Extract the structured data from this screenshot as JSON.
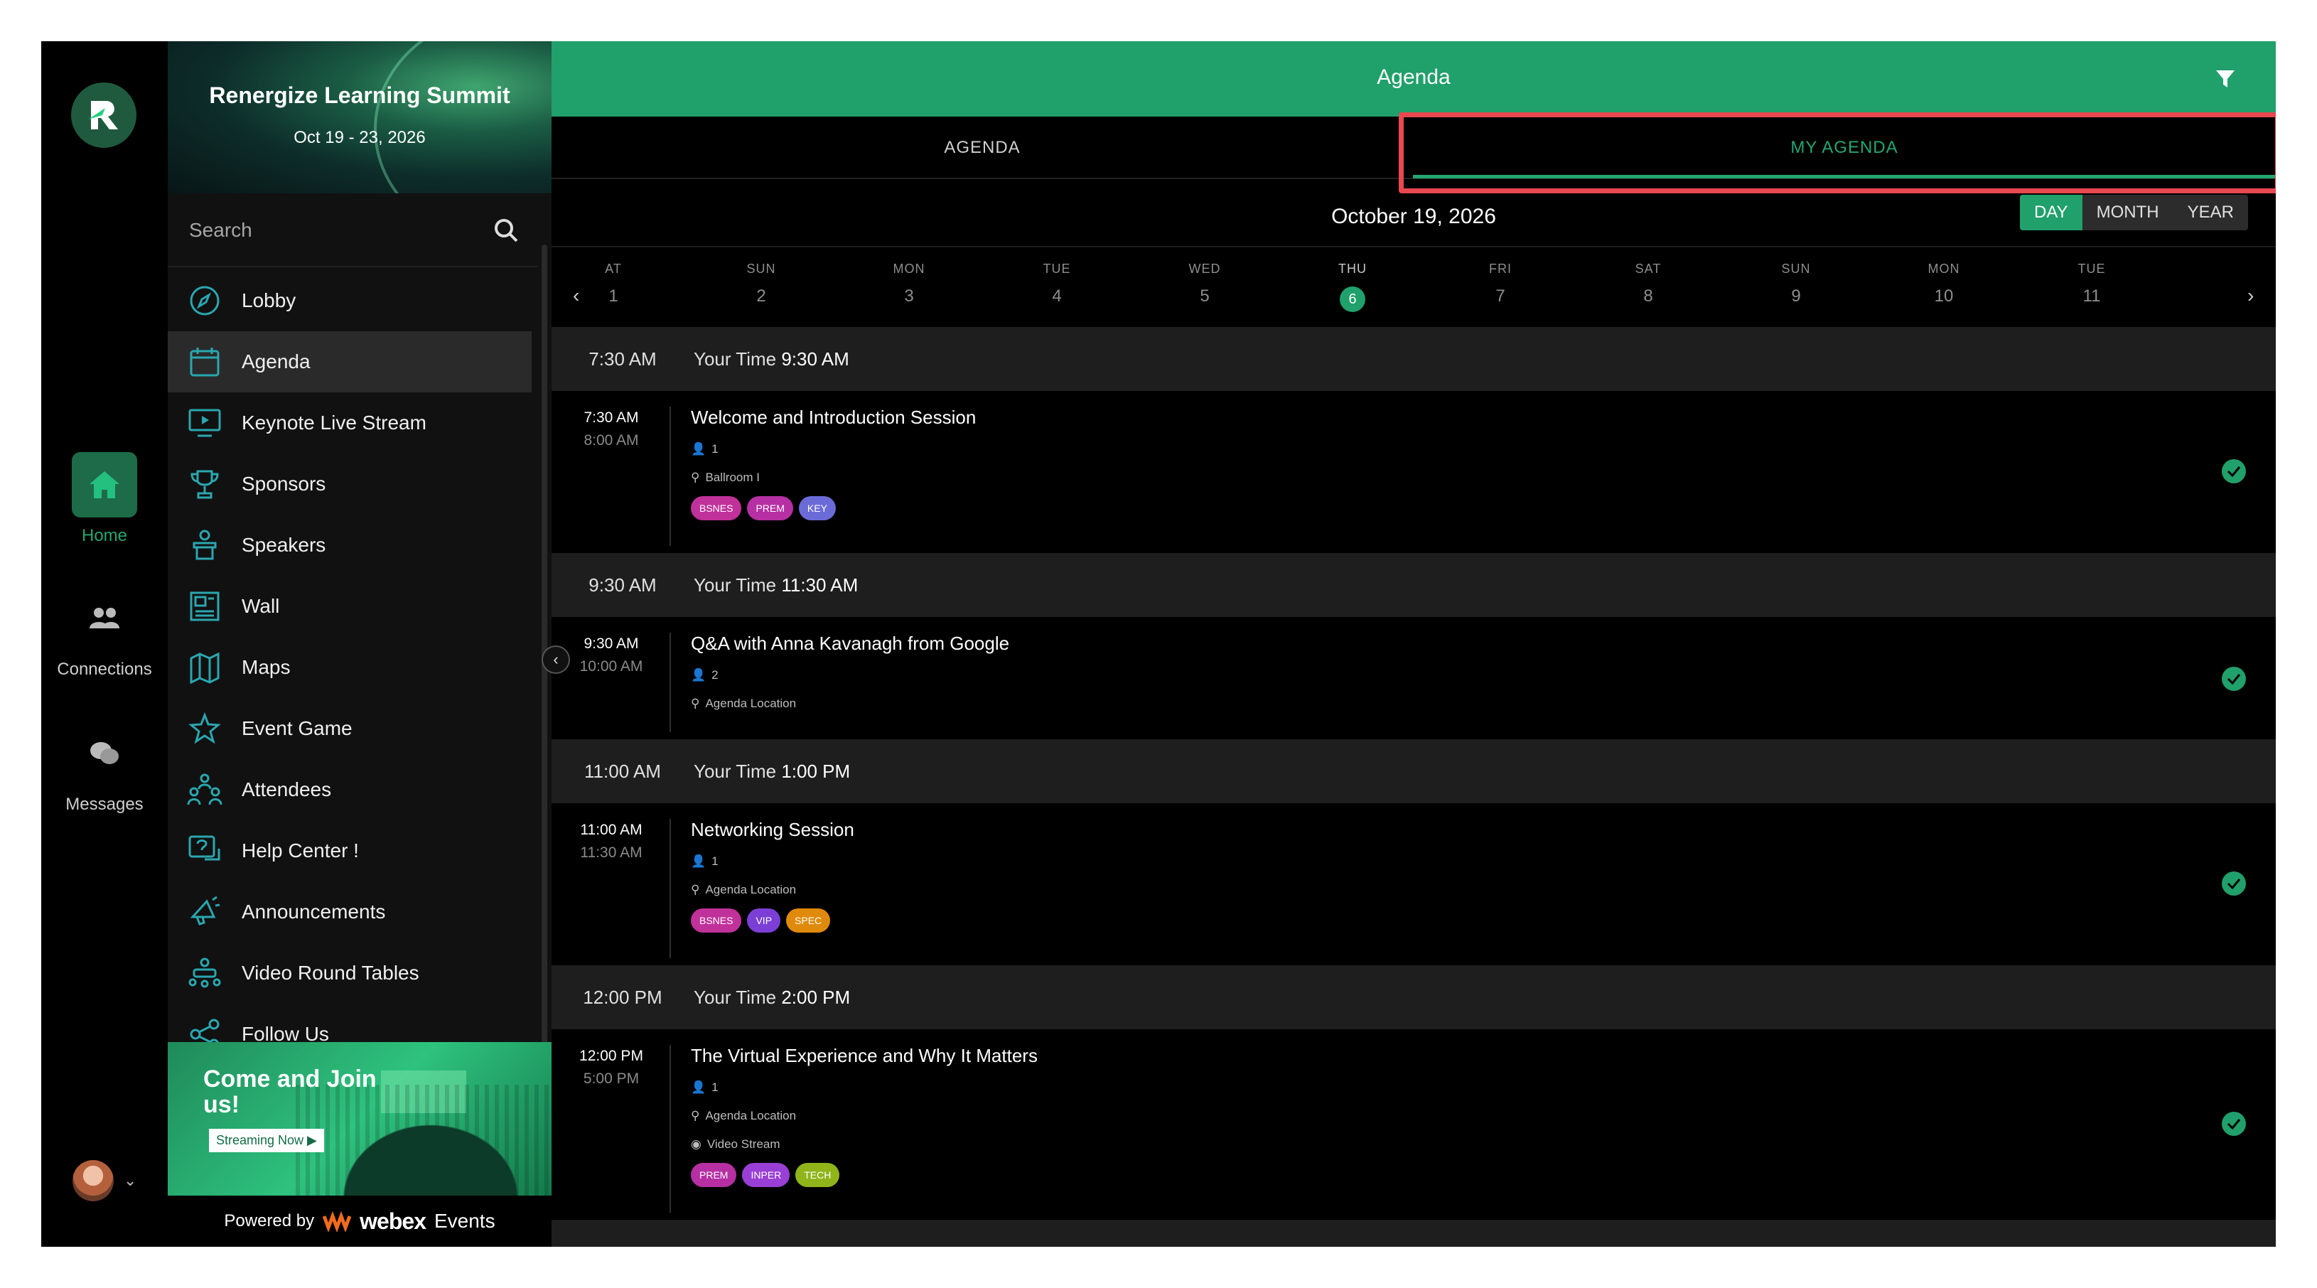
{
  "rail": {
    "items": [
      {
        "label": "Home",
        "icon": "home-icon"
      },
      {
        "label": "Connections",
        "icon": "people-icon"
      },
      {
        "label": "Messages",
        "icon": "chat-icon"
      }
    ]
  },
  "sidebar": {
    "event_title": "Renergize Learning Summit",
    "event_dates": "Oct 19 - 23, 2026",
    "search_placeholder": "Search",
    "menu": [
      {
        "label": "Lobby",
        "icon": "compass-icon"
      },
      {
        "label": "Agenda",
        "icon": "calendar-icon"
      },
      {
        "label": "Keynote Live Stream",
        "icon": "monitor-play-icon"
      },
      {
        "label": "Sponsors",
        "icon": "trophy-icon"
      },
      {
        "label": "Speakers",
        "icon": "podium-icon"
      },
      {
        "label": "Wall",
        "icon": "newspaper-icon"
      },
      {
        "label": "Maps",
        "icon": "map-icon"
      },
      {
        "label": "Event Game",
        "icon": "star-icon"
      },
      {
        "label": "Attendees",
        "icon": "attendees-icon"
      },
      {
        "label": "Help Center !",
        "icon": "help-icon"
      },
      {
        "label": "Announcements",
        "icon": "megaphone-icon"
      },
      {
        "label": "Video Round Tables",
        "icon": "round-table-icon"
      },
      {
        "label": "Follow Us",
        "icon": "share-icon"
      }
    ],
    "promo_title": "Come and Join us!",
    "promo_button": "Streaming Now ▶",
    "powered_by": "Powered by",
    "brand_word": "webex",
    "brand_suffix": "Events"
  },
  "header": {
    "title": "Agenda",
    "tabs": [
      "AGENDA",
      "MY AGENDA"
    ]
  },
  "calendar": {
    "current_date": "October 19, 2026",
    "views": [
      "DAY",
      "MONTH",
      "YEAR"
    ],
    "days": [
      {
        "dn": "AT",
        "dd": "1"
      },
      {
        "dn": "SUN",
        "dd": "2"
      },
      {
        "dn": "MON",
        "dd": "3"
      },
      {
        "dn": "TUE",
        "dd": "4"
      },
      {
        "dn": "WED",
        "dd": "5"
      },
      {
        "dn": "THU",
        "dd": "6"
      },
      {
        "dn": "FRI",
        "dd": "7"
      },
      {
        "dn": "SAT",
        "dd": "8"
      },
      {
        "dn": "SUN",
        "dd": "9"
      },
      {
        "dn": "MON",
        "dd": "10"
      },
      {
        "dn": "TUE",
        "dd": "11"
      }
    ]
  },
  "agenda": {
    "your_time_label": "Your Time",
    "slots": [
      {
        "time": "7:30 AM",
        "your_time": "9:30 AM",
        "start": "7:30 AM",
        "end": "8:00 AM",
        "title": "Welcome and Introduction Session",
        "attendees": "1",
        "location": "Ballroom I",
        "tags": [
          {
            "label": "BSNES",
            "color": "#c0319a"
          },
          {
            "label": "PREM",
            "color": "#b62fa3"
          },
          {
            "label": "KEY",
            "color": "#6b6bd8"
          }
        ]
      },
      {
        "time": "9:30 AM",
        "your_time": "11:30 AM",
        "start": "9:30 AM",
        "end": "10:00 AM",
        "title": "Q&A with Anna Kavanagh from Google",
        "attendees": "2",
        "location": "Agenda Location"
      },
      {
        "time": "11:00 AM",
        "your_time": "1:00 PM",
        "start": "11:00 AM",
        "end": "11:30 AM",
        "title": "Networking Session",
        "attendees": "1",
        "location": "Agenda Location",
        "tags": [
          {
            "label": "BSNES",
            "color": "#c0319a"
          },
          {
            "label": "VIP",
            "color": "#7b3fd6"
          },
          {
            "label": "SPEC",
            "color": "#e08a0c"
          }
        ]
      },
      {
        "time": "12:00 PM",
        "your_time": "2:00 PM",
        "start": "12:00 PM",
        "end": "5:00 PM",
        "title": "The Virtual Experience and Why It Matters",
        "attendees": "1",
        "location": "Agenda Location",
        "stream": "Video Stream",
        "tags": [
          {
            "label": "PREM",
            "color": "#b62fa3"
          },
          {
            "label": "INPER",
            "color": "#9a3fd6"
          },
          {
            "label": "TECH",
            "color": "#8fb51a"
          }
        ]
      }
    ]
  }
}
